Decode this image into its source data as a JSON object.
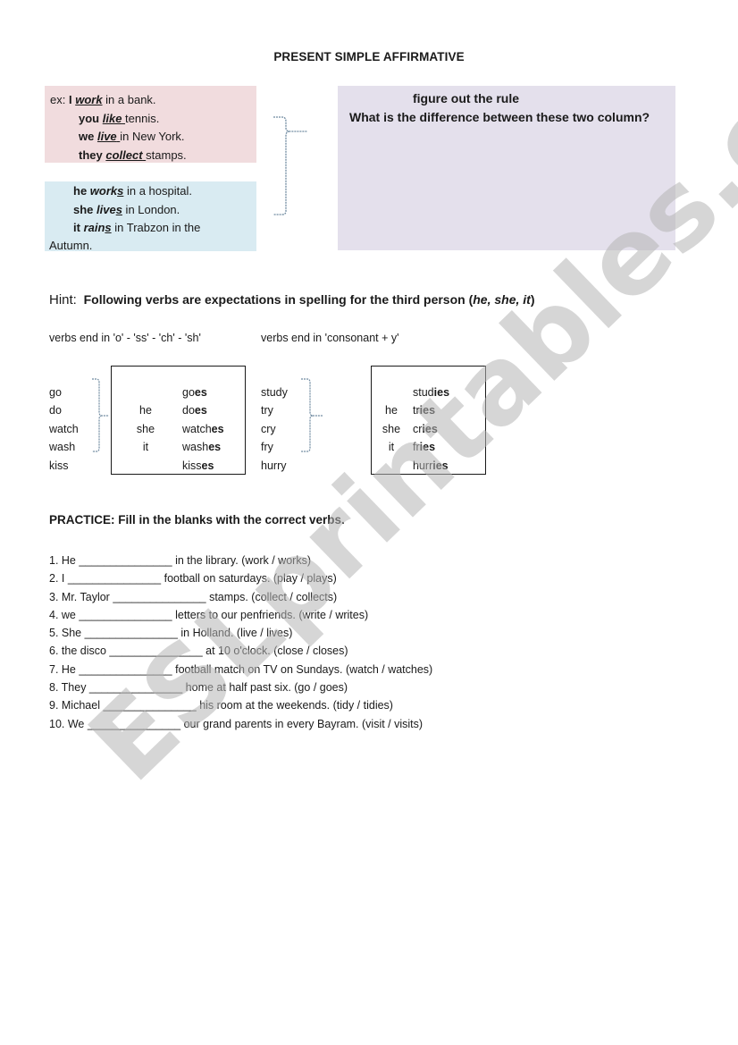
{
  "title": "PRESENT SIMPLE AFFIRMATIVE",
  "examples_pink": [
    {
      "prefix": "ex:  ",
      "subject": "I ",
      "verb": "work",
      "suffix": "",
      "rest": " in a bank."
    },
    {
      "prefix": "",
      "subject": "you ",
      "verb": "like",
      "suffix": " ",
      "rest": "tennis."
    },
    {
      "prefix": "",
      "subject": "we ",
      "verb": "live",
      "suffix": " ",
      "rest": "in New York."
    },
    {
      "prefix": "",
      "subject": "they ",
      "verb": "collect",
      "suffix": " ",
      "rest": "stamps."
    }
  ],
  "examples_blue": [
    {
      "subject": "he ",
      "verb": "work",
      "ending": "s",
      "rest": " in a hospital."
    },
    {
      "subject": "she ",
      "verb": "live",
      "ending": "s",
      "rest": " in London."
    },
    {
      "subject": "it ",
      "verb": "rain",
      "ending": "s",
      "rest": " in Trabzon in the"
    },
    {
      "continuation": "Autumn."
    }
  ],
  "rule_box": {
    "line1": "figure out the rule",
    "line2": "What is the difference between these two column?"
  },
  "hint": {
    "label": "Hint:",
    "text": "  Following verbs are expectations in spelling for the third person (",
    "pronouns": "he, she, it",
    "close": ")"
  },
  "group1": {
    "heading": "verbs end in 'o' - 'ss' - 'ch' - 'sh'",
    "base_verbs": [
      "go",
      "do",
      "watch",
      "wash",
      "kiss"
    ],
    "pronouns": [
      "",
      "he",
      "she",
      "it",
      ""
    ],
    "forms": [
      {
        "stem": "go",
        "ending": "es"
      },
      {
        "stem": "do",
        "ending": "es"
      },
      {
        "stem": "watch",
        "ending": "es"
      },
      {
        "stem": "wash",
        "ending": "es"
      },
      {
        "stem": "kiss",
        "ending": "es"
      }
    ]
  },
  "group2": {
    "heading": "verbs end in 'consonant + y'",
    "base_verbs": [
      "study",
      "try",
      "cry",
      "fry",
      "hurry"
    ],
    "pronouns": [
      "",
      "he",
      "she",
      "it",
      ""
    ],
    "forms": [
      {
        "stem": "stud",
        "ending": "ies"
      },
      {
        "stem": "tr",
        "ending": "ies"
      },
      {
        "stem": "cr",
        "ending": "ies"
      },
      {
        "stem": "fr",
        "ending": "ies"
      },
      {
        "stem": "hurr",
        "ending": "ies"
      }
    ]
  },
  "practice": {
    "heading": "PRACTICE:  Fill in the blanks with the correct verbs.",
    "exercises": [
      "1. He _______________ in the library.  (work / works)",
      "2. I _______________ football on saturdays. (play / plays)",
      "3. Mr. Taylor _______________ stamps. (collect / collects)",
      "4. we _______________ letters to our penfriends. (write / writes)",
      "5. She _______________ in Holland. (live / lives)",
      "6. the disco _______________ at 10 o'clock. (close / closes)",
      "7. He _______________ football match on TV on Sundays. (watch / watches)",
      "8. They _______________ home at half past six. (go / goes)",
      "9. Michael _______________ his room at the weekends. (tidy / tidies)",
      "10.  We _______________ our grand parents in every Bayram.  (visit / visits)"
    ]
  },
  "watermark": "ESLprintables.com",
  "colors": {
    "pink_box": "#f1dcde",
    "blue_box": "#d9ebf2",
    "purple_box": "#e4e0ec",
    "brace": "#6f8aa0",
    "watermark": "#c8c8c8"
  }
}
